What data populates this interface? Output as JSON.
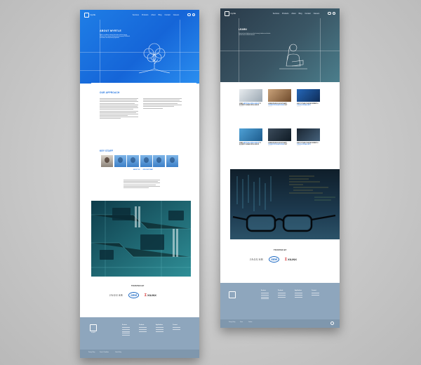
{
  "left": {
    "nav": {
      "logo": "myrtle",
      "links": [
        "Services",
        "Products",
        "About",
        "Blog",
        "Contact",
        "Careers"
      ]
    },
    "hero": {
      "title": "ABOUT MYRTLE",
      "paragraph": "Myrtle is a software company that makes machine learning inference faster, cheaper and greener by designing FPGA-based accelerators and deep learning algorithms."
    },
    "approach": {
      "title": "OUR APPROACH",
      "col1": "Machine learning is moving into every industry. We work with researchers and engineers to deploy models on efficient hardware.",
      "col2": "Our approach combines hardware design and software expertise to deliver production-grade performance."
    },
    "staff": {
      "title": "KEY STAFF",
      "links": [
        "ABOUT US",
        "JOIN OUR TEAM"
      ],
      "paragraph": "Our team brings together experts across silicon, systems and artificial intelligence research."
    },
    "trusted": {
      "title": "TRUSTED BY",
      "brands": [
        "JAGUAR",
        "intel",
        "XILINX"
      ]
    },
    "footer": {
      "logo": "myrtle",
      "columns": [
        {
          "title": "Services"
        },
        {
          "title": "Products"
        },
        {
          "title": "Applications"
        },
        {
          "title": "Connect"
        }
      ],
      "bottom_links": [
        "Privacy Policy",
        "Terms & Conditions",
        "Cookie Policy"
      ]
    }
  },
  "right": {
    "nav": {
      "logo": "myrtle",
      "links": [
        "Services",
        "Products",
        "About",
        "Blog",
        "Contact",
        "Careers"
      ]
    },
    "hero": {
      "title": "LEARN",
      "paragraph": "Read our latest thinking on machine learning, hardware acceleration and the future of efficient inference."
    },
    "posts": [
      {
        "title_a": "USING",
        "title_b": "ARTIFICIAL INTELLIGENCE",
        "title_c": "TO AUGMENT HUMAN INTELLIGENCE",
        "meta": "Read more"
      },
      {
        "title_a": "LOREM IPSUM DOLOR SIT AMET",
        "title_b": "CONSECTETUR ADIPISCING",
        "title_c": "ELIT",
        "meta": "Read more"
      },
      {
        "title_a": "HOW TO TRAIN YOUR RECURRENT &",
        "title_b": "CONVOLUTIONAL NETS",
        "title_c": "",
        "meta": "Read more"
      },
      {
        "title_a": "USING",
        "title_b": "ARTIFICIAL INTELLIGENCE",
        "title_c": "TO AUGMENT HUMAN INTELLIGENCE",
        "meta": "Read more"
      },
      {
        "title_a": "LOREM IPSUM DOLOR SIT AMET",
        "title_b": "CONSECTETUR ADIPISCING",
        "title_c": "ELIT",
        "meta": "Read more"
      },
      {
        "title_a": "HOW TO TRAIN YOUR RECURRENT &",
        "title_b": "CONVOLUTIONAL NETS",
        "title_c": "",
        "meta": "Read more"
      }
    ],
    "trusted": {
      "title": "TRUSTED BY",
      "brands": [
        "JAGUAR",
        "intel",
        "XILINX"
      ]
    },
    "footer": {
      "columns": [
        {
          "title": "Services"
        },
        {
          "title": "Products"
        },
        {
          "title": "Applications"
        },
        {
          "title": "Connect"
        }
      ],
      "bottom_links": [
        "Privacy Policy",
        "Terms",
        "Cookies"
      ]
    }
  },
  "colors": {
    "brand_blue": "#1a6fde",
    "dark_teal": "#2f4a57",
    "footer": "#8ea6bd"
  }
}
